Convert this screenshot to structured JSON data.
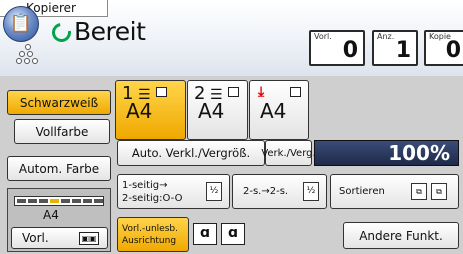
{
  "app": {
    "title": "Kopierer",
    "logo_icon": "copier-app-icon"
  },
  "status": {
    "text": "Bereit",
    "ring_color": "#00a44a"
  },
  "counters": [
    {
      "label": "Vorl.",
      "value": "0"
    },
    {
      "label": "Anz.",
      "value": "1"
    },
    {
      "label": "Kopie",
      "value": "0"
    }
  ],
  "color_mode": {
    "schwarzweiss": "Schwarzweiß",
    "vollfarbe": "Vollfarbe",
    "autom_farbe": "Autom. Farbe"
  },
  "paper": {
    "size": "A4",
    "size_orientation_icon": "landscape-paper-icon"
  },
  "vorl": {
    "label": "Vorl.",
    "icon": "original-orientation-icon"
  },
  "trays": [
    {
      "number": "1",
      "size": "A4",
      "selected": true
    },
    {
      "number": "2",
      "size": "A4",
      "selected": false
    },
    {
      "number": "",
      "size": "A4",
      "selected": false,
      "bypass": true
    }
  ],
  "zoom": {
    "auto_label": "Auto. Verkl./Vergröß.",
    "verk_verg_label": "Verk./Verg.",
    "value": "100%"
  },
  "duplex": {
    "line1": "1-seitig→",
    "line2": "2-seitig:O-O",
    "icon1": "½",
    "second_label": "2-s.→2-s.",
    "icon2": "½"
  },
  "sortieren": {
    "label": "Sortieren"
  },
  "unlesb": {
    "line1": "Vorl.-unlesb.",
    "line2": "Ausrichtung"
  },
  "andere": {
    "label": "Andere Funkt."
  },
  "colors": {
    "selected": "#f0a800",
    "zoom_bg": "#1e2a4a"
  }
}
